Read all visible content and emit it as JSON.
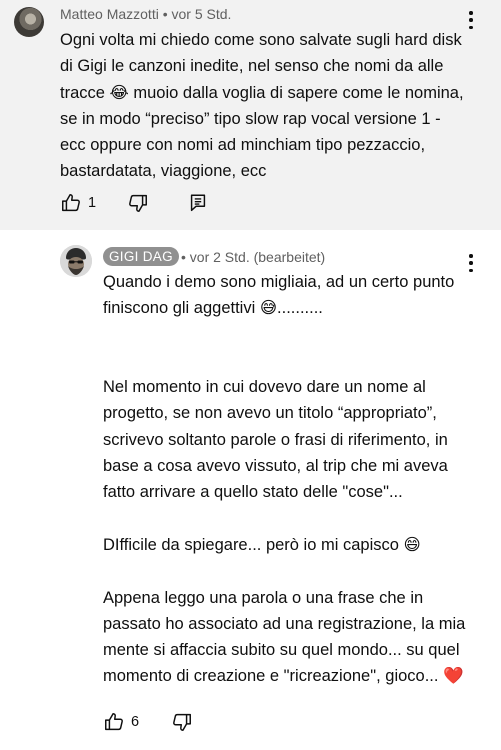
{
  "comment": {
    "author": "Matteo Mazzotti",
    "time": "• vor 5 Std.",
    "text": "Ogni volta mi chiedo come sono salvate sugli hard disk di Gigi le canzoni inedite, nel senso che nomi da alle tracce 😂 muoio dalla voglia di sapere come le nomina, se in modo “preciso” tipo slow rap vocal versione 1 - ecc oppure con nomi ad minchiam tipo pezzaccio, bastardatata, viaggione, ecc",
    "like_count": "1",
    "icons": {
      "more": "more-vert-icon",
      "like": "thumb-up-icon",
      "dislike": "thumb-down-icon",
      "reply": "reply-icon"
    }
  },
  "reply": {
    "author": "GIGI DAG",
    "time": "• vor 2 Std. (bearbeitet)",
    "text": "Quando i demo sono migliaia, ad un certo punto finiscono gli aggettivi 😅..........\n\n\nNel momento in cui dovevo dare un nome al progetto, se non avevo un titolo “appropriato”, scrivevo soltanto parole o frasi di riferimento, in base a cosa avevo vissuto, al trip che mi aveva fatto arrivare a quello stato delle \"cose\"...\n\nDIfficile da spiegare... però io mi capisco 😄\n\nAppena leggo una parola o una frase che in passato ho associato ad una registrazione, la mia mente si affaccia subito su quel mondo... su quel momento di creazione e \"ricreazione\", gioco... ❤️",
    "like_count": "6",
    "icons": {
      "more": "more-vert-icon",
      "like": "thumb-up-icon",
      "dislike": "thumb-down-icon"
    }
  },
  "colors": {
    "highlight_background": "#f2f2f2",
    "secondary_text": "#606060",
    "creator_badge": "#909090"
  }
}
